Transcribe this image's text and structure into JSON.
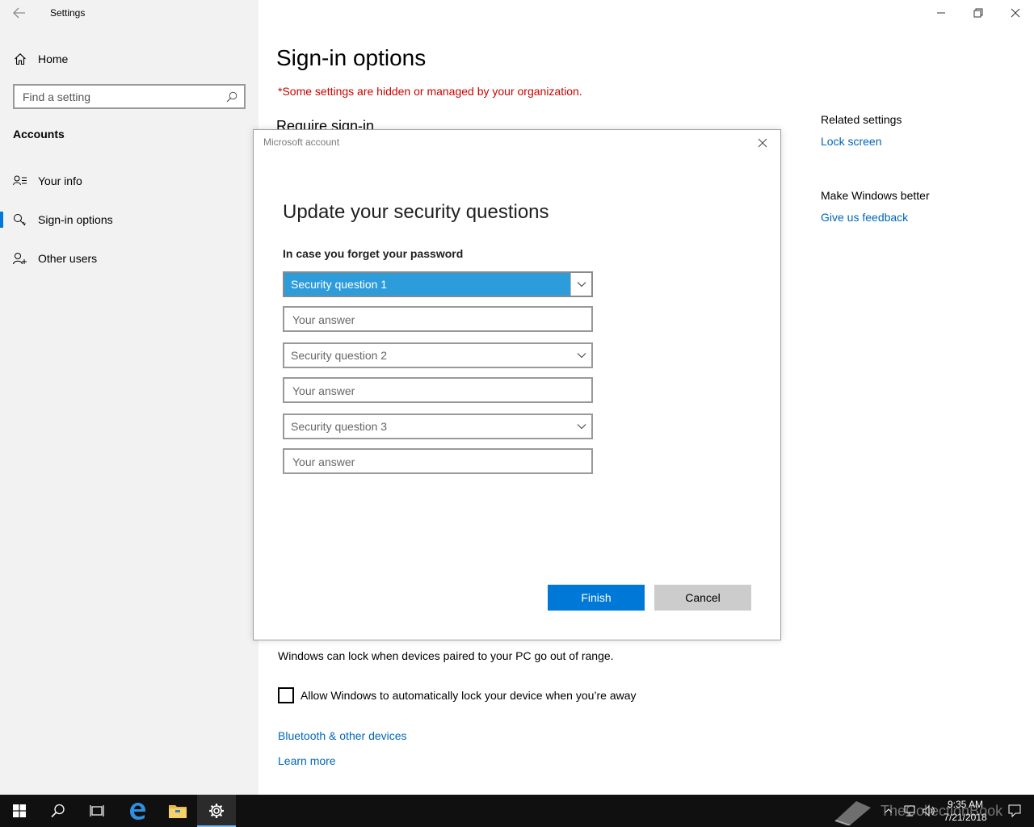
{
  "window": {
    "app_title": "Settings"
  },
  "nav": {
    "home": "Home",
    "search_placeholder": "Find a setting",
    "section": "Accounts",
    "items": [
      {
        "label": "Your info",
        "icon": "person-card-icon"
      },
      {
        "label": "Sign-in options",
        "icon": "key-icon",
        "active": true
      },
      {
        "label": "Other users",
        "icon": "add-person-icon"
      }
    ]
  },
  "main": {
    "title": "Sign-in options",
    "org_notice": "*Some settings are hidden or managed by your organization.",
    "section_heading": "Require sign-in",
    "dynamic_lock_text": "Windows can lock when devices paired to your PC go out of range.",
    "checkbox_label": "Allow Windows to automatically lock your device when you’re away",
    "bluetooth_link": "Bluetooth & other devices",
    "learn_more_link": "Learn more"
  },
  "related": {
    "title": "Related settings",
    "lock_screen_link": "Lock screen",
    "better_title": "Make Windows better",
    "feedback_link": "Give us feedback"
  },
  "dialog": {
    "title": "Microsoft account",
    "heading": "Update your security questions",
    "subheading": "In case you forget your password",
    "questions": [
      {
        "selected": "Security question 1",
        "answer_placeholder": "Your answer"
      },
      {
        "selected": "Security question 2",
        "answer_placeholder": "Your answer"
      },
      {
        "selected": "Security question 3",
        "answer_placeholder": "Your answer"
      }
    ],
    "finish_label": "Finish",
    "cancel_label": "Cancel"
  },
  "taskbar": {
    "time": "9:35 AM",
    "date": "7/21/2018",
    "watermark": "TheCollectionBook"
  },
  "colors": {
    "accent": "#0078d7",
    "link": "#0067b8",
    "warning": "#c50500",
    "focused_select": "#2d9cdb"
  }
}
